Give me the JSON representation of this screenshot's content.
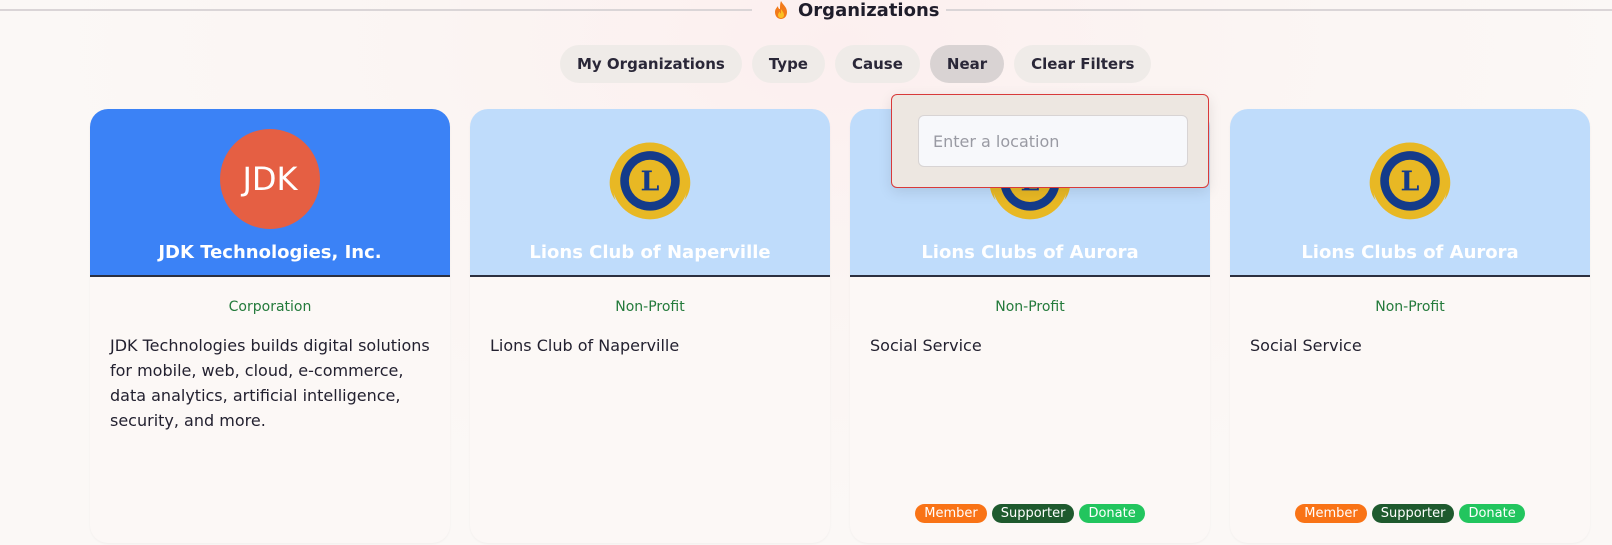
{
  "header": {
    "title": "Organizations",
    "icon": "flame-icon"
  },
  "filters": [
    {
      "label": "My Organizations",
      "active": false
    },
    {
      "label": "Type",
      "active": false
    },
    {
      "label": "Cause",
      "active": false
    },
    {
      "label": "Near",
      "active": true
    },
    {
      "label": "Clear Filters",
      "active": false
    }
  ],
  "location_popover": {
    "placeholder": "Enter a location",
    "value": ""
  },
  "cards": [
    {
      "name": "JDK Technologies, Inc.",
      "avatar_initials": "JDK",
      "type": "Corporation",
      "description": "JDK Technologies builds digital solutions for mobile, web, cloud, e-commerce, data analytics, artificial intelligence, security, and more.",
      "badges": []
    },
    {
      "name": "Lions Club of Naperville",
      "logo": "lions-international-logo",
      "type": "Non-Profit",
      "description": "Lions Club of Naperville",
      "badges": []
    },
    {
      "name": "Lions Clubs of Aurora",
      "logo": "lions-international-logo",
      "type": "Non-Profit",
      "description": "Social Service",
      "badges": [
        "Member",
        "Supporter",
        "Donate"
      ]
    },
    {
      "name": "Lions Clubs of Aurora",
      "logo": "lions-international-logo",
      "type": "Non-Profit",
      "description": "Social Service",
      "badges": [
        "Member",
        "Supporter",
        "Donate"
      ]
    }
  ],
  "colors": {
    "card_head_light": "#bfdcfb",
    "card_head_blue": "#3b82f6",
    "avatar": "#e55f43",
    "type_text": "#237a3b",
    "member": "#f97316",
    "supporter": "#1e5a2e",
    "donate": "#22c55e"
  }
}
